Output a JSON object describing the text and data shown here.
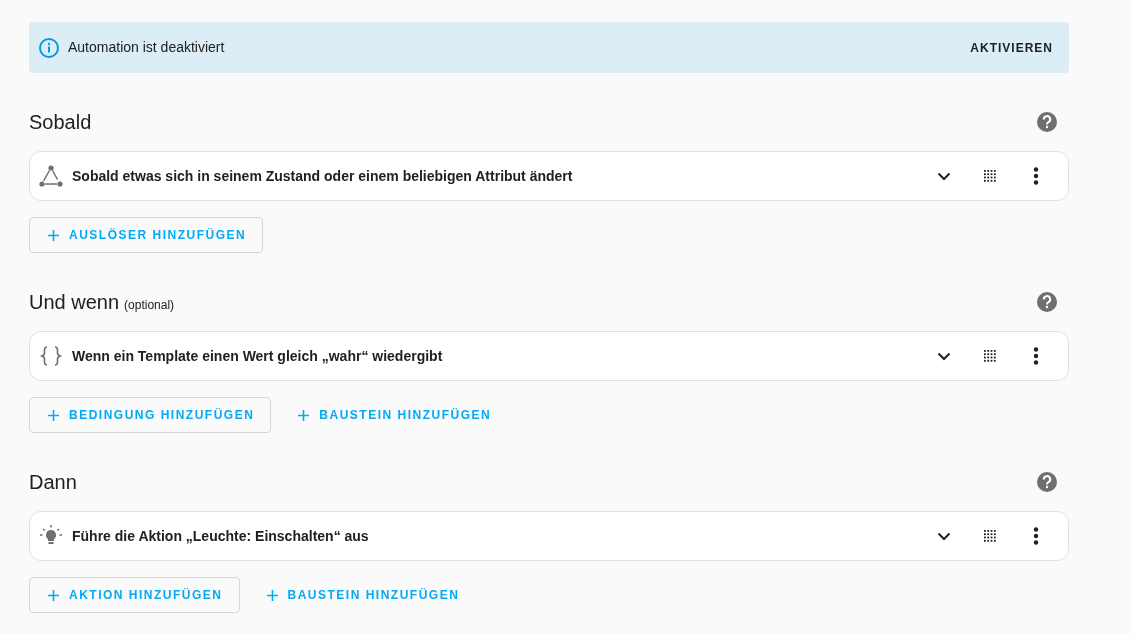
{
  "alert": {
    "message": "Automation ist deaktiviert",
    "action": "AKTIVIEREN"
  },
  "sections": [
    {
      "title": "Sobald",
      "items": [
        {
          "kind": "trigger",
          "label": "Sobald etwas sich in seinem Zustand oder einem beliebigen Attribut ändert"
        }
      ],
      "buttons": [
        {
          "kind": "outlined",
          "label": "AUSLÖSER HINZUFÜGEN"
        }
      ]
    },
    {
      "title": "Und wenn",
      "note": "(optional)",
      "items": [
        {
          "kind": "template",
          "label": "Wenn ein Template einen Wert gleich „wahr“ wiedergibt"
        }
      ],
      "buttons": [
        {
          "kind": "outlined",
          "label": "BEDINGUNG HINZUFÜGEN"
        },
        {
          "kind": "text",
          "label": "BAUSTEIN HINZUFÜGEN"
        }
      ]
    },
    {
      "title": "Dann",
      "items": [
        {
          "kind": "light",
          "label": "Führe die Aktion „Leuchte: Einschalten“ aus"
        }
      ],
      "buttons": [
        {
          "kind": "outlined",
          "label": "AKTION HINZUFÜGEN"
        },
        {
          "kind": "text",
          "label": "BAUSTEIN HINZUFÜGEN"
        }
      ]
    }
  ]
}
